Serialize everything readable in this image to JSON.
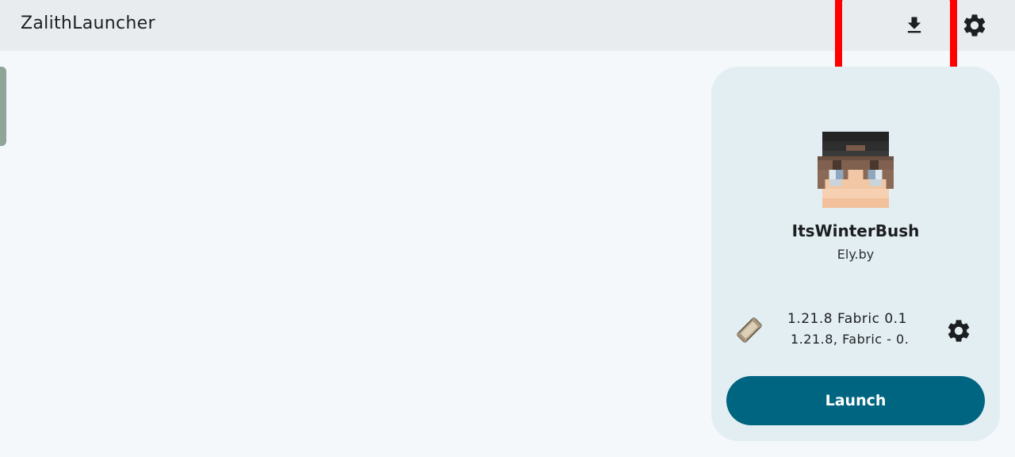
{
  "app": {
    "title": "ZalithLauncher"
  },
  "toolbar": {
    "download_icon": "download-icon",
    "settings_icon": "gear-icon"
  },
  "account": {
    "username": "ItsWinterBush",
    "type": "Ely.by"
  },
  "version": {
    "name": "1.21.8 Fabric 0.1",
    "description": "1.21.8, Fabric - 0.",
    "icon": "fabric-icon",
    "settings_icon": "gear-icon"
  },
  "launch": {
    "label": "Launch"
  },
  "colors": {
    "accent": "#006580",
    "highlight": "#ff0000",
    "panel": "#e3eef3"
  }
}
